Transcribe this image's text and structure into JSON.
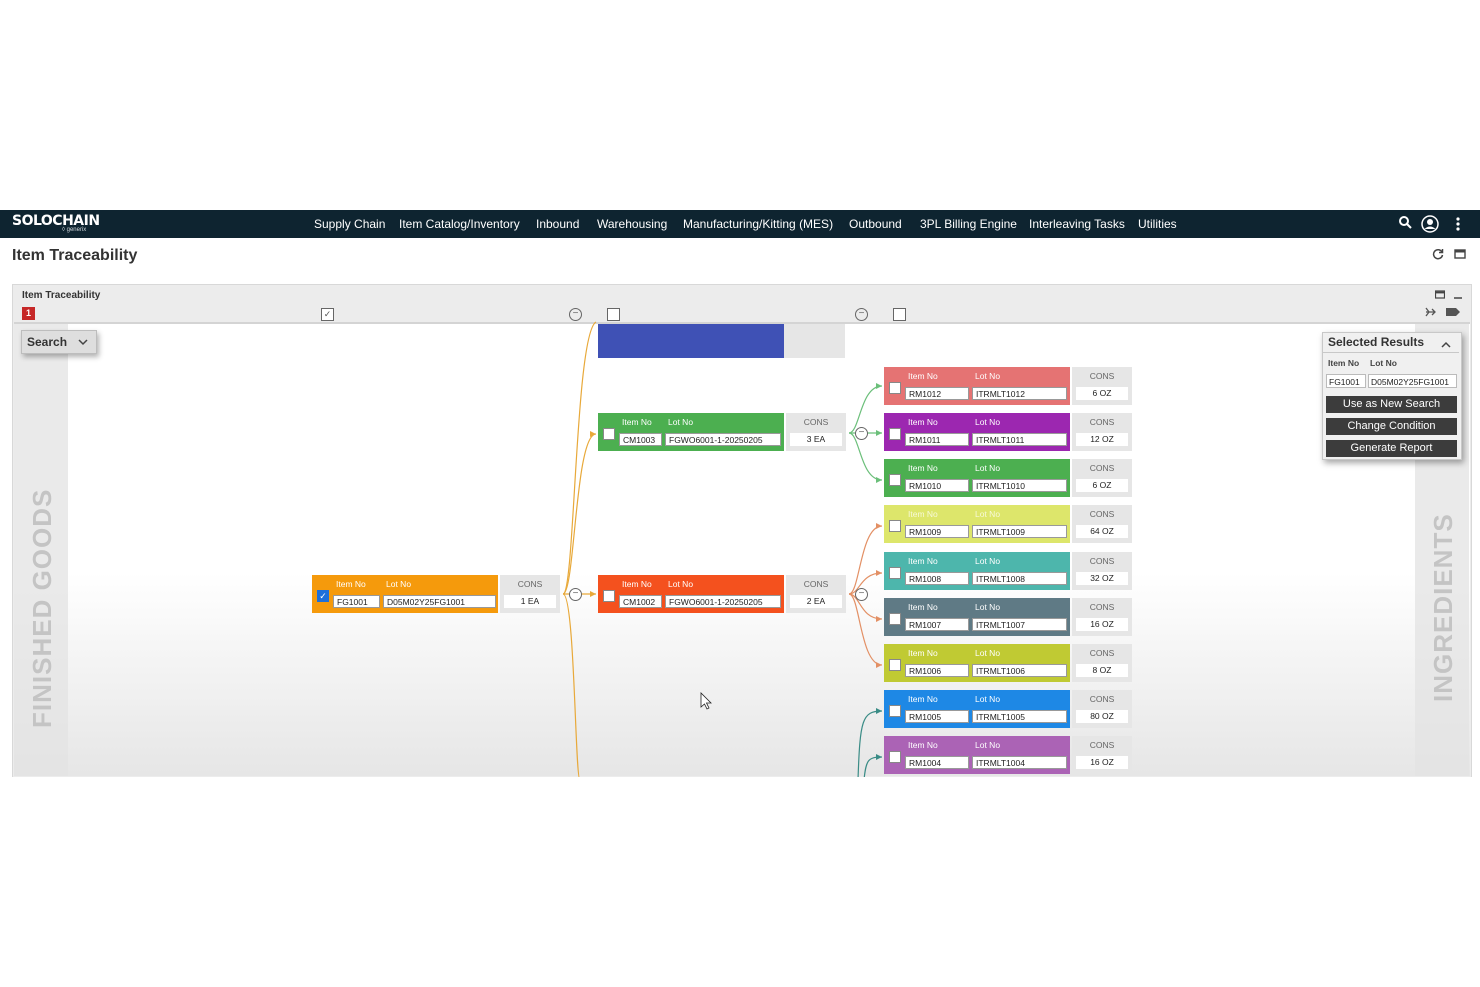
{
  "app": {
    "logo": "SOLOCHAIN",
    "logo_sub": "◊ generix",
    "nav": [
      "Supply Chain",
      "Item Catalog/Inventory",
      "Inbound",
      "Warehousing",
      "Manufacturing/Kitting (MES)",
      "Outbound",
      "3PL Billing Engine",
      "Interleaving Tasks",
      "Utilities"
    ],
    "icons": {
      "search": "search-icon",
      "user": "user-icon",
      "more": "more-vertical-icon"
    }
  },
  "page": {
    "title": "Item Traceability",
    "icons": [
      "refresh-icon",
      "maximize-icon"
    ]
  },
  "panel": {
    "title": "Item Traceability",
    "badge": "1",
    "search_label": "Search",
    "left_label": "FINISHED GOODS",
    "right_label": "INGREDIENTS"
  },
  "labels": {
    "item_no": "Item No",
    "lot_no": "Lot No",
    "cons": "CONS"
  },
  "colors": {
    "orange": "#f59a0c",
    "green": "#4caf50",
    "red_orange": "#f4511e",
    "salmon": "#e57373",
    "purple": "#9c27b0",
    "lime_light": "#dde66b",
    "teal": "#4db6ac",
    "slate": "#5f7a85",
    "olive": "#c0ca33",
    "blue": "#1e88e5",
    "violet": "#ab63b5",
    "indigo": "#3f51b5"
  },
  "nodes": {
    "fg1001": {
      "item": "FG1001",
      "lot": "D05M02Y25FG1001",
      "cons": "1 EA",
      "checked": true
    },
    "cm1003": {
      "item": "CM1003",
      "lot": "FGWO6001-1-20250205",
      "cons": "3 EA"
    },
    "cm1002": {
      "item": "CM1002",
      "lot": "FGWO6001-1-20250205",
      "cons": "2 EA"
    },
    "rm1012": {
      "item": "RM1012",
      "lot": "ITRMLT1012",
      "cons": "6 OZ"
    },
    "rm1011": {
      "item": "RM1011",
      "lot": "ITRMLT1011",
      "cons": "12 OZ"
    },
    "rm1010": {
      "item": "RM1010",
      "lot": "ITRMLT1010",
      "cons": "6 OZ"
    },
    "rm1009": {
      "item": "RM1009",
      "lot": "ITRMLT1009",
      "cons": "64 OZ"
    },
    "rm1008": {
      "item": "RM1008",
      "lot": "ITRMLT1008",
      "cons": "32 OZ"
    },
    "rm1007": {
      "item": "RM1007",
      "lot": "ITRMLT1007",
      "cons": "16 OZ"
    },
    "rm1006": {
      "item": "RM1006",
      "lot": "ITRMLT1006",
      "cons": "8 OZ"
    },
    "rm1005": {
      "item": "RM1005",
      "lot": "ITRMLT1005",
      "cons": "80 OZ"
    },
    "rm1004": {
      "item": "RM1004",
      "lot": "ITRMLT1004",
      "cons": "16 OZ"
    }
  },
  "selected": {
    "title": "Selected Results",
    "col_item": "Item No",
    "col_lot": "Lot No",
    "item": "FG1001",
    "lot": "D05M02Y25FG1001",
    "buttons": [
      "Use as New Search",
      "Change Condition",
      "Generate Report"
    ]
  }
}
